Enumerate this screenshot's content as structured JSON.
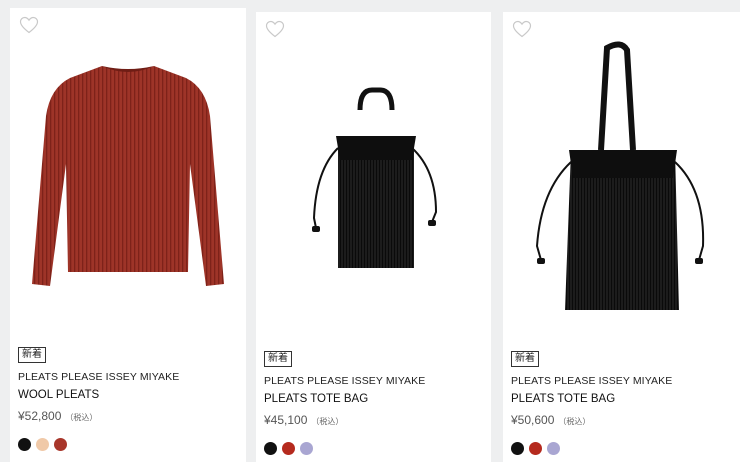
{
  "products": [
    {
      "badge": "新着",
      "brand": "PLEATS PLEASE ISSEY MIYAKE",
      "name": "WOOL PLEATS",
      "price": "¥52,800",
      "tax": "（税込）",
      "colors": [
        "#111111",
        "#f0c9a8",
        "#a8362a"
      ]
    },
    {
      "badge": "新着",
      "brand": "PLEATS PLEASE ISSEY MIYAKE",
      "name": "PLEATS TOTE BAG",
      "price": "¥45,100",
      "tax": "（税込）",
      "colors": [
        "#111111",
        "#b52a1e",
        "#a9a6d2"
      ]
    },
    {
      "badge": "新着",
      "brand": "PLEATS PLEASE ISSEY MIYAKE",
      "name": "PLEATS TOTE BAG",
      "price": "¥50,600",
      "tax": "（税込）",
      "colors": [
        "#111111",
        "#b52a1e",
        "#a9a6d2"
      ]
    }
  ],
  "icons": {
    "favorite": "heart-outline-icon"
  }
}
